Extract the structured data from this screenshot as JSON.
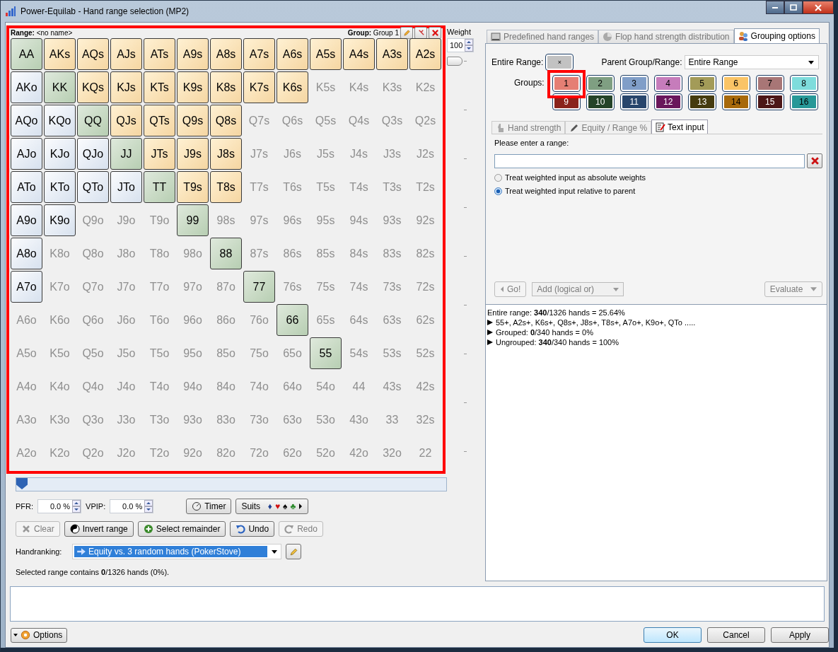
{
  "window": {
    "title": "Power-Equilab - Hand range selection (MP2)"
  },
  "range_panel": {
    "range_label": "Range:",
    "range_name": "<no name>",
    "group_label": "Group:",
    "group_name": "Group 1",
    "highlighted": true,
    "grid": [
      [
        {
          "hand": "AA",
          "selected": true
        },
        {
          "hand": "AKs",
          "selected": true
        },
        {
          "hand": "AQs",
          "selected": true
        },
        {
          "hand": "AJs",
          "selected": true
        },
        {
          "hand": "ATs",
          "selected": true
        },
        {
          "hand": "A9s",
          "selected": true
        },
        {
          "hand": "A8s",
          "selected": true
        },
        {
          "hand": "A7s",
          "selected": true
        },
        {
          "hand": "A6s",
          "selected": true
        },
        {
          "hand": "A5s",
          "selected": true
        },
        {
          "hand": "A4s",
          "selected": true
        },
        {
          "hand": "A3s",
          "selected": true
        },
        {
          "hand": "A2s",
          "selected": true
        }
      ],
      [
        {
          "hand": "AKo",
          "selected": true
        },
        {
          "hand": "KK",
          "selected": true
        },
        {
          "hand": "KQs",
          "selected": true
        },
        {
          "hand": "KJs",
          "selected": true
        },
        {
          "hand": "KTs",
          "selected": true
        },
        {
          "hand": "K9s",
          "selected": true
        },
        {
          "hand": "K8s",
          "selected": true
        },
        {
          "hand": "K7s",
          "selected": true
        },
        {
          "hand": "K6s",
          "selected": true
        },
        {
          "hand": "K5s",
          "selected": false
        },
        {
          "hand": "K4s",
          "selected": false
        },
        {
          "hand": "K3s",
          "selected": false
        },
        {
          "hand": "K2s",
          "selected": false
        }
      ],
      [
        {
          "hand": "AQo",
          "selected": true
        },
        {
          "hand": "KQo",
          "selected": true
        },
        {
          "hand": "QQ",
          "selected": true
        },
        {
          "hand": "QJs",
          "selected": true
        },
        {
          "hand": "QTs",
          "selected": true
        },
        {
          "hand": "Q9s",
          "selected": true
        },
        {
          "hand": "Q8s",
          "selected": true
        },
        {
          "hand": "Q7s",
          "selected": false
        },
        {
          "hand": "Q6s",
          "selected": false
        },
        {
          "hand": "Q5s",
          "selected": false
        },
        {
          "hand": "Q4s",
          "selected": false
        },
        {
          "hand": "Q3s",
          "selected": false
        },
        {
          "hand": "Q2s",
          "selected": false
        }
      ],
      [
        {
          "hand": "AJo",
          "selected": true
        },
        {
          "hand": "KJo",
          "selected": true
        },
        {
          "hand": "QJo",
          "selected": true
        },
        {
          "hand": "JJ",
          "selected": true
        },
        {
          "hand": "JTs",
          "selected": true
        },
        {
          "hand": "J9s",
          "selected": true
        },
        {
          "hand": "J8s",
          "selected": true
        },
        {
          "hand": "J7s",
          "selected": false
        },
        {
          "hand": "J6s",
          "selected": false
        },
        {
          "hand": "J5s",
          "selected": false
        },
        {
          "hand": "J4s",
          "selected": false
        },
        {
          "hand": "J3s",
          "selected": false
        },
        {
          "hand": "J2s",
          "selected": false
        }
      ],
      [
        {
          "hand": "ATo",
          "selected": true
        },
        {
          "hand": "KTo",
          "selected": true
        },
        {
          "hand": "QTo",
          "selected": true
        },
        {
          "hand": "JTo",
          "selected": true
        },
        {
          "hand": "TT",
          "selected": true
        },
        {
          "hand": "T9s",
          "selected": true
        },
        {
          "hand": "T8s",
          "selected": true
        },
        {
          "hand": "T7s",
          "selected": false
        },
        {
          "hand": "T6s",
          "selected": false
        },
        {
          "hand": "T5s",
          "selected": false
        },
        {
          "hand": "T4s",
          "selected": false
        },
        {
          "hand": "T3s",
          "selected": false
        },
        {
          "hand": "T2s",
          "selected": false
        }
      ],
      [
        {
          "hand": "A9o",
          "selected": true
        },
        {
          "hand": "K9o",
          "selected": true
        },
        {
          "hand": "Q9o",
          "selected": false
        },
        {
          "hand": "J9o",
          "selected": false
        },
        {
          "hand": "T9o",
          "selected": false
        },
        {
          "hand": "99",
          "selected": true
        },
        {
          "hand": "98s",
          "selected": false
        },
        {
          "hand": "97s",
          "selected": false
        },
        {
          "hand": "96s",
          "selected": false
        },
        {
          "hand": "95s",
          "selected": false
        },
        {
          "hand": "94s",
          "selected": false
        },
        {
          "hand": "93s",
          "selected": false
        },
        {
          "hand": "92s",
          "selected": false
        }
      ],
      [
        {
          "hand": "A8o",
          "selected": true
        },
        {
          "hand": "K8o",
          "selected": false
        },
        {
          "hand": "Q8o",
          "selected": false
        },
        {
          "hand": "J8o",
          "selected": false
        },
        {
          "hand": "T8o",
          "selected": false
        },
        {
          "hand": "98o",
          "selected": false
        },
        {
          "hand": "88",
          "selected": true
        },
        {
          "hand": "87s",
          "selected": false
        },
        {
          "hand": "86s",
          "selected": false
        },
        {
          "hand": "85s",
          "selected": false
        },
        {
          "hand": "84s",
          "selected": false
        },
        {
          "hand": "83s",
          "selected": false
        },
        {
          "hand": "82s",
          "selected": false
        }
      ],
      [
        {
          "hand": "A7o",
          "selected": true
        },
        {
          "hand": "K7o",
          "selected": false
        },
        {
          "hand": "Q7o",
          "selected": false
        },
        {
          "hand": "J7o",
          "selected": false
        },
        {
          "hand": "T7o",
          "selected": false
        },
        {
          "hand": "97o",
          "selected": false
        },
        {
          "hand": "87o",
          "selected": false
        },
        {
          "hand": "77",
          "selected": true
        },
        {
          "hand": "76s",
          "selected": false
        },
        {
          "hand": "75s",
          "selected": false
        },
        {
          "hand": "74s",
          "selected": false
        },
        {
          "hand": "73s",
          "selected": false
        },
        {
          "hand": "72s",
          "selected": false
        }
      ],
      [
        {
          "hand": "A6o",
          "selected": false
        },
        {
          "hand": "K6o",
          "selected": false
        },
        {
          "hand": "Q6o",
          "selected": false
        },
        {
          "hand": "J6o",
          "selected": false
        },
        {
          "hand": "T6o",
          "selected": false
        },
        {
          "hand": "96o",
          "selected": false
        },
        {
          "hand": "86o",
          "selected": false
        },
        {
          "hand": "76o",
          "selected": false
        },
        {
          "hand": "66",
          "selected": true
        },
        {
          "hand": "65s",
          "selected": false
        },
        {
          "hand": "64s",
          "selected": false
        },
        {
          "hand": "63s",
          "selected": false
        },
        {
          "hand": "62s",
          "selected": false
        }
      ],
      [
        {
          "hand": "A5o",
          "selected": false
        },
        {
          "hand": "K5o",
          "selected": false
        },
        {
          "hand": "Q5o",
          "selected": false
        },
        {
          "hand": "J5o",
          "selected": false
        },
        {
          "hand": "T5o",
          "selected": false
        },
        {
          "hand": "95o",
          "selected": false
        },
        {
          "hand": "85o",
          "selected": false
        },
        {
          "hand": "75o",
          "selected": false
        },
        {
          "hand": "65o",
          "selected": false
        },
        {
          "hand": "55",
          "selected": true
        },
        {
          "hand": "54s",
          "selected": false
        },
        {
          "hand": "53s",
          "selected": false
        },
        {
          "hand": "52s",
          "selected": false
        }
      ],
      [
        {
          "hand": "A4o",
          "selected": false
        },
        {
          "hand": "K4o",
          "selected": false
        },
        {
          "hand": "Q4o",
          "selected": false
        },
        {
          "hand": "J4o",
          "selected": false
        },
        {
          "hand": "T4o",
          "selected": false
        },
        {
          "hand": "94o",
          "selected": false
        },
        {
          "hand": "84o",
          "selected": false
        },
        {
          "hand": "74o",
          "selected": false
        },
        {
          "hand": "64o",
          "selected": false
        },
        {
          "hand": "54o",
          "selected": false
        },
        {
          "hand": "44",
          "selected": false
        },
        {
          "hand": "43s",
          "selected": false
        },
        {
          "hand": "42s",
          "selected": false
        }
      ],
      [
        {
          "hand": "A3o",
          "selected": false
        },
        {
          "hand": "K3o",
          "selected": false
        },
        {
          "hand": "Q3o",
          "selected": false
        },
        {
          "hand": "J3o",
          "selected": false
        },
        {
          "hand": "T3o",
          "selected": false
        },
        {
          "hand": "93o",
          "selected": false
        },
        {
          "hand": "83o",
          "selected": false
        },
        {
          "hand": "73o",
          "selected": false
        },
        {
          "hand": "63o",
          "selected": false
        },
        {
          "hand": "53o",
          "selected": false
        },
        {
          "hand": "43o",
          "selected": false
        },
        {
          "hand": "33",
          "selected": false
        },
        {
          "hand": "32s",
          "selected": false
        }
      ],
      [
        {
          "hand": "A2o",
          "selected": false
        },
        {
          "hand": "K2o",
          "selected": false
        },
        {
          "hand": "Q2o",
          "selected": false
        },
        {
          "hand": "J2o",
          "selected": false
        },
        {
          "hand": "T2o",
          "selected": false
        },
        {
          "hand": "92o",
          "selected": false
        },
        {
          "hand": "82o",
          "selected": false
        },
        {
          "hand": "72o",
          "selected": false
        },
        {
          "hand": "62o",
          "selected": false
        },
        {
          "hand": "52o",
          "selected": false
        },
        {
          "hand": "42o",
          "selected": false
        },
        {
          "hand": "32o",
          "selected": false
        },
        {
          "hand": "22",
          "selected": false
        }
      ]
    ]
  },
  "weight": {
    "label": "Weight",
    "value": "100",
    "level": 1
  },
  "range_slider": {
    "level": 0
  },
  "pfr": {
    "label": "PFR:",
    "value": "0.0 %"
  },
  "vpip": {
    "label": "VPIP:",
    "value": "0.0 %"
  },
  "timer_button": "Timer",
  "suits_button": {
    "label": "Suits",
    "suits": [
      {
        "glyph": "♦",
        "color": "#1f3f8f"
      },
      {
        "glyph": "♥",
        "color": "#d01010"
      },
      {
        "glyph": "♠",
        "color": "#000000"
      },
      {
        "glyph": "♣",
        "color": "#2a8a2a"
      }
    ]
  },
  "actions": [
    {
      "label": "Clear",
      "kind": "clear",
      "disabled": true
    },
    {
      "label": "Invert range",
      "kind": "invert",
      "disabled": false
    },
    {
      "label": "Select remainder",
      "kind": "add",
      "disabled": false
    },
    {
      "label": "Undo",
      "kind": "undo",
      "disabled": false
    },
    {
      "label": "Redo",
      "kind": "redo",
      "disabled": true
    }
  ],
  "handranking": {
    "label": "Handranking:",
    "value": "Equity vs. 3 random hands (PokerStove)"
  },
  "status": "Selected range contains **0**/1326 hands (0%).",
  "tabs": [
    {
      "label": "Predefined hand ranges",
      "kind": "ranges",
      "selected": false
    },
    {
      "label": "Flop hand strength distribution",
      "kind": "pie",
      "selected": false
    },
    {
      "label": "Grouping options",
      "kind": "people",
      "selected": true
    }
  ],
  "grouping": {
    "entire_range_label": "Entire Range:",
    "entire_range_button": "×",
    "parent_label": "Parent Group/Range:",
    "parent_value": "Entire Range",
    "groups_label": "Groups:",
    "groups": [
      {
        "label": "1",
        "color": "#e57f74",
        "highlighted": true
      },
      {
        "label": "2",
        "color": "#7f9f82",
        "highlighted": false
      },
      {
        "label": "3",
        "color": "#809ec8",
        "highlighted": false
      },
      {
        "label": "4",
        "color": "#c67cbb",
        "highlighted": false
      },
      {
        "label": "5",
        "color": "#a39b58",
        "highlighted": false
      },
      {
        "label": "6",
        "color": "#fac466",
        "highlighted": false
      },
      {
        "label": "7",
        "color": "#a87676",
        "highlighted": false
      },
      {
        "label": "8",
        "color": "#7edcdc",
        "highlighted": false
      },
      {
        "label": "9",
        "color": "#8a231b",
        "highlighted": false
      },
      {
        "label": "10",
        "color": "#244328",
        "highlighted": false
      },
      {
        "label": "11",
        "color": "#28466c",
        "highlighted": false
      },
      {
        "label": "12",
        "color": "#69175b",
        "highlighted": false
      },
      {
        "label": "13",
        "color": "#453b0e",
        "highlighted": false
      },
      {
        "label": "14",
        "color": "#a7690b",
        "highlighted": false
      },
      {
        "label": "15",
        "color": "#4c1717",
        "highlighted": false
      },
      {
        "label": "16",
        "color": "#279898",
        "highlighted": false
      }
    ]
  },
  "sub_tabs": [
    {
      "label": "Hand strength",
      "kind": "hand",
      "selected": false
    },
    {
      "label": "Equity / Range %",
      "kind": "pencil",
      "selected": false
    },
    {
      "label": "Text input",
      "kind": "note",
      "selected": true
    }
  ],
  "text_input": {
    "prompt": "Please enter a range:"
  },
  "radios": [
    {
      "label": "Treat weighted input as absolute weights",
      "selected": false
    },
    {
      "label": "Treat weighted input relative to parent",
      "selected": true
    }
  ],
  "go_button": {
    "label": "Go!",
    "disabled": true
  },
  "combine_select": {
    "value": "Add (logical or)",
    "disabled": true
  },
  "evaluate_button": {
    "label": "Evaluate",
    "disabled": true
  },
  "summary": [
    {
      "text": "Entire range: **340**/1326 hands = 25.64%",
      "expandable": false
    },
    {
      "text": "55+, A2s+, K6s+, Q8s+, J8s+, T8s+, A7o+, K9o+, QTo .....",
      "expandable": true
    },
    {
      "text": "Grouped: **0**/340 hands = 0%",
      "expandable": true
    },
    {
      "text": "Ungrouped: **340**/340 hands = 100%",
      "expandable": true
    }
  ],
  "options_button": "Options",
  "dialog_buttons": [
    {
      "label": "OK",
      "default": true
    },
    {
      "label": "Cancel",
      "default": false
    },
    {
      "label": "Apply",
      "default": false
    }
  ]
}
